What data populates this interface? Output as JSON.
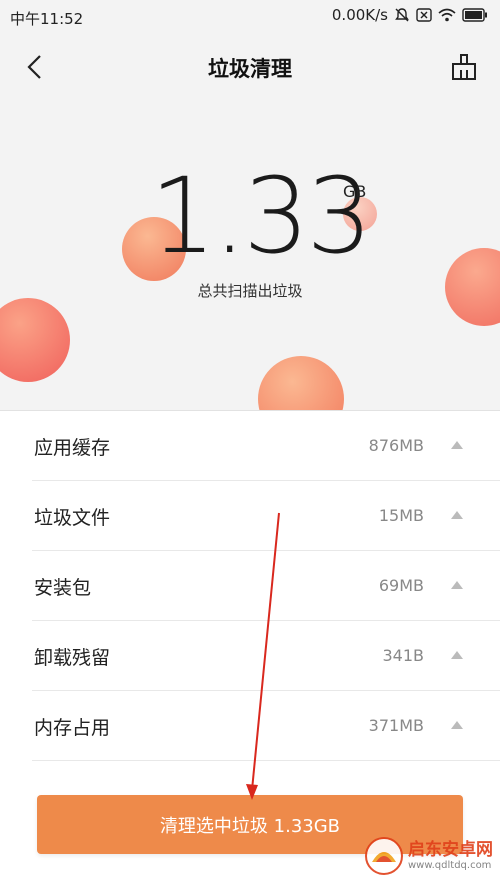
{
  "status_bar": {
    "time": "中午11:52",
    "network_speed": "0.00K/s"
  },
  "header": {
    "title": "垃圾清理"
  },
  "summary": {
    "amount": "1.33",
    "unit": "GB",
    "caption": "总共扫描出垃圾"
  },
  "items": [
    {
      "label": "应用缓存",
      "size": "876MB"
    },
    {
      "label": "垃圾文件",
      "size": "15MB"
    },
    {
      "label": "安装包",
      "size": "69MB"
    },
    {
      "label": "卸载残留",
      "size": "341B"
    },
    {
      "label": "内存占用",
      "size": "371MB"
    }
  ],
  "action": {
    "clean_label": "清理选中垃圾 1.33GB"
  },
  "watermark": {
    "title": "启东安卓网",
    "url": "www.qdltdq.com"
  },
  "colors": {
    "accent": "#ee8a4a",
    "hero_bg": "#f3f3f3",
    "annotation_arrow": "#d9281e"
  }
}
